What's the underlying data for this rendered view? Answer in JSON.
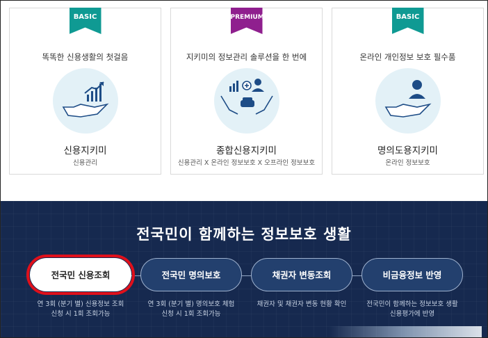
{
  "cards": [
    {
      "badge": "BASIC",
      "tagline": "똑똑한 신용생활의 첫걸음",
      "name": "신용지키미",
      "desc": "신용관리",
      "icon": "hand-chart-icon"
    },
    {
      "badge": "PREMIUM",
      "tagline": "지키미의 정보관리 솔루션을 한 번에",
      "name": "종합신용지키미",
      "desc": "신용관리 X 온라인 정보보호 X 오프라인 정보보호",
      "icon": "hands-chart-person-car-icon"
    },
    {
      "badge": "BASIC",
      "tagline": "온라인 개인정보 보호 필수품",
      "name": "명의도용지키미",
      "desc": "온라인 정보보호",
      "icon": "hand-person-icon"
    }
  ],
  "section": {
    "title": "전국민이 함께하는 정보보호 생활",
    "steps": [
      {
        "label": "전국민 신용조회",
        "note_line1": "연 3회 (분기 별) 신용정보 조회",
        "note_line2": "신청 시 1회 조회가능"
      },
      {
        "label": "전국민 명의보호",
        "note_line1": "연 3회 (분기 별) 명의보호 체험",
        "note_line2": "신청 시 1회 조회가능"
      },
      {
        "label": "채권자 변동조회",
        "note_line1": "채권자 및 채권자 변동 현황 확인",
        "note_line2": ""
      },
      {
        "label": "비금융정보 반영",
        "note_line1": "전국민이 함께하는 정보보호 생활",
        "note_line2": "신용평가에 반영"
      }
    ]
  },
  "colors": {
    "basic": "#0f9a93",
    "premium": "#8f1f8e",
    "navy": "#16294f",
    "highlight": "#e0101b"
  }
}
